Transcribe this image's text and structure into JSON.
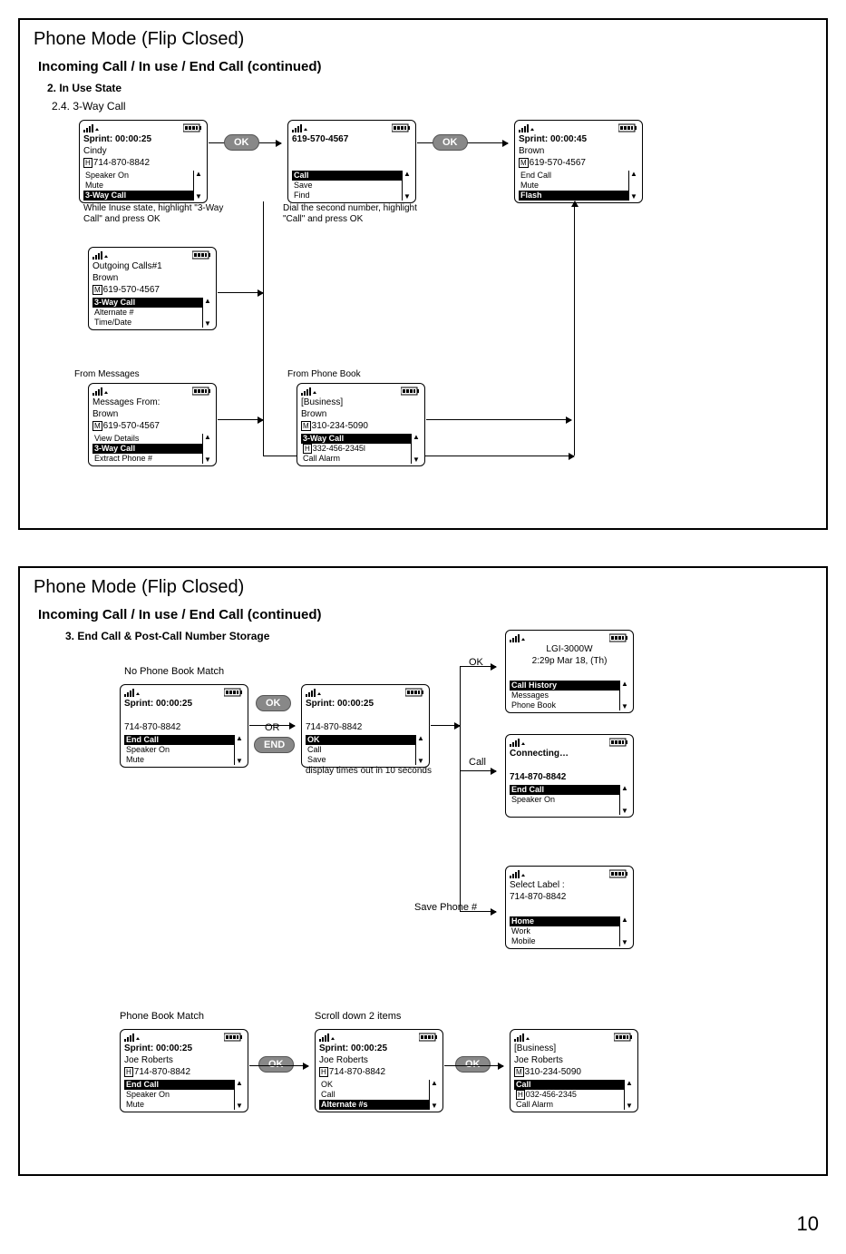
{
  "page_number": "10",
  "panel1": {
    "title": "Phone Mode (Flip Closed)",
    "section": "Incoming Call / In use / End Call (continued)",
    "sub": "2. In Use State",
    "subsub": "2.4. 3-Way Call",
    "ok1": "OK",
    "ok2": "OK",
    "s1": {
      "l1": "Sprint:  00:00:25",
      "l2": "Cindy",
      "tag": "H",
      "l3": "714-870-8842",
      "m1": "Speaker On",
      "m2": "Mute",
      "m3": "3-Way Call"
    },
    "cap1": "While Inuse state, highlight \"3-Way Call\" and press OK",
    "s2": {
      "l1": "619-570-4567",
      "m1": "Call",
      "m2": "Save",
      "m3": "Find"
    },
    "cap2": "Dial the second number, highlight \"Call\" and press OK",
    "s3": {
      "l1": "Sprint:  00:00:45",
      "l2": "Brown",
      "tag": "M",
      "l3": "619-570-4567",
      "m1": "End Call",
      "m2": "Mute",
      "m3": "Flash"
    },
    "s4": {
      "l1": "Outgoing Calls#1",
      "l2": "Brown",
      "tag": "M",
      "l3": "619-570-4567",
      "m1": "3-Way Call",
      "m2": "Alternate #",
      "m3": "Time/Date"
    },
    "fromMsg": "From Messages",
    "s5": {
      "l1": "Messages From:",
      "l2": "Brown",
      "tag": "M",
      "l3": "619-570-4567",
      "m1": "View Details",
      "m2": "3-Way Call",
      "m3": "Extract Phone #"
    },
    "fromPb": "From Phone Book",
    "s6": {
      "l1": "[Business]",
      "l2": "Brown",
      "tag": "M",
      "l3": "310-234-5090",
      "m1": "3-Way Call",
      "tag2": "H",
      "m2": "332-456-2345l",
      "m3": "Call Alarm"
    }
  },
  "panel2": {
    "title": "Phone Mode (Flip Closed)",
    "section": "Incoming Call / In use / End Call (continued)",
    "sub": "3. End Call & Post-Call Number Storage",
    "noMatch": "No Phone Book Match",
    "ok": "OK",
    "or": "OR",
    "end": "END",
    "okLabel": "OK",
    "callLabel": "Call",
    "saveLabel": "Save Phone #",
    "pbMatch": "Phone Book Match",
    "scroll2": "Scroll down 2 items",
    "cap_timeout": "display times out in 10 seconds",
    "p1": {
      "l1": "Sprint:  00:00:25",
      "l3": "714-870-8842",
      "m1": "End Call",
      "m2": "Speaker On",
      "m3": "Mute"
    },
    "p2": {
      "l1": "Sprint:  00:00:25",
      "l3": "714-870-8842",
      "m1": "OK",
      "m2": "Call",
      "m3": "Save"
    },
    "p3": {
      "l1": "LGI-3000W",
      "l2": "2:29p Mar 18, (Th)",
      "m1": "Call History",
      "m2": "Messages",
      "m3": "Phone Book"
    },
    "p4": {
      "l1": "Connecting…",
      "l3": "714-870-8842",
      "m1": "End Call",
      "m2": "Speaker On"
    },
    "p5": {
      "l1": "Select Label :",
      "l2": "714-870-8842",
      "m1": "Home",
      "m2": "Work",
      "m3": "Mobile"
    },
    "p6": {
      "l1": "Sprint:  00:00:25",
      "l2": "Joe Roberts",
      "tag": "H",
      "l3": "714-870-8842",
      "m1": "End Call",
      "m2": "Speaker On",
      "m3": "Mute"
    },
    "p7": {
      "l1": "Sprint:  00:00:25",
      "l2": "Joe Roberts",
      "tag": "H",
      "l3": "714-870-8842",
      "m1": "OK",
      "m2": "Call",
      "m3": "Alternate #s"
    },
    "p8": {
      "l1": "[Business]",
      "l2": "Joe Roberts",
      "tag": "M",
      "l3": "310-234-5090",
      "m1": "Call",
      "tag2": "H",
      "m2": "032-456-2345",
      "m3": "Call Alarm"
    }
  }
}
